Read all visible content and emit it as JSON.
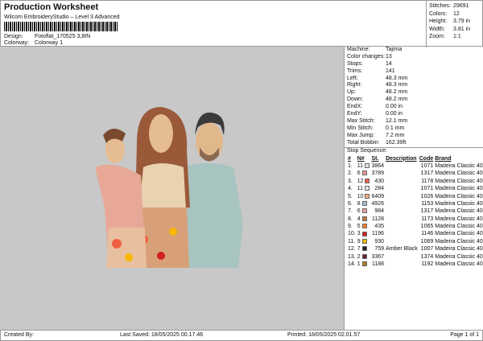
{
  "header": {
    "title": "Production Worksheet",
    "subtitle": "Wilcom EmbroideryStudio – Level 3 Advanced",
    "design_label": "Design:",
    "design_value": "Fotoflat_170525 3,8IN",
    "colorway_label": "Colorway:",
    "colorway_value": "Colorway 1"
  },
  "stats": [
    {
      "k": "Stitches:",
      "v": "29691"
    },
    {
      "k": "Colors:",
      "v": "12"
    },
    {
      "k": "Height:",
      "v": "3.79 in"
    },
    {
      "k": "Width:",
      "v": "3.81 in"
    },
    {
      "k": "Zoom:",
      "v": "1:1"
    }
  ],
  "info": [
    {
      "k": "Machine:",
      "v": "Tajima"
    },
    {
      "k": "Color changes:",
      "v": "13"
    },
    {
      "k": "Stops:",
      "v": "14"
    },
    {
      "k": "Trims:",
      "v": "141"
    },
    {
      "k": "Left:",
      "v": "48.3 mm"
    },
    {
      "k": "Right:",
      "v": "48.3 mm"
    },
    {
      "k": "Up:",
      "v": "48.2 mm"
    },
    {
      "k": "Down:",
      "v": "48.2 mm"
    },
    {
      "k": "EndX:",
      "v": "0.00 in"
    },
    {
      "k": "EndY:",
      "v": "0.00 in"
    },
    {
      "k": "Max Stitch:",
      "v": "12.1 mm"
    },
    {
      "k": "Min Stitch:",
      "v": "0.1 mm"
    },
    {
      "k": "Max Jump:",
      "v": "7.2 mm"
    },
    {
      "k": "Total Bobbin:",
      "v": "162.39ft"
    }
  ],
  "stop_sequence": {
    "title": "Stop Sequence:",
    "headers": [
      "#",
      "N#",
      "St.",
      "Description",
      "Code",
      "Brand"
    ],
    "rows": [
      [
        "1.",
        "11",
        "#e8e2dc",
        "3864",
        "",
        "1071",
        "Madeira Classic 40"
      ],
      [
        "2.",
        "6",
        "#e89a94",
        "3789",
        "",
        "1317",
        "Madeira Classic 40"
      ],
      [
        "3.",
        "12",
        "#f06040",
        "430",
        "",
        "1178",
        "Madeira Classic 40"
      ],
      [
        "4.",
        "11",
        "#ece2d8",
        "284",
        "",
        "1071",
        "Madeira Classic 40"
      ],
      [
        "5.",
        "10",
        "#f0b080",
        "6409",
        "",
        "1026",
        "Madeira Classic 40"
      ],
      [
        "6.",
        "8",
        "#a8bcd4",
        "4926",
        "",
        "1153",
        "Madeira Classic 40"
      ],
      [
        "7.",
        "6",
        "#e8a0a0",
        "984",
        "",
        "1317",
        "Madeira Classic 40"
      ],
      [
        "8.",
        "4",
        "#c07840",
        "1128",
        "",
        "1173",
        "Madeira Classic 40"
      ],
      [
        "9.",
        "5",
        "#f08030",
        "435",
        "",
        "1065",
        "Madeira Classic 40"
      ],
      [
        "10.",
        "3",
        "#d02020",
        "1196",
        "",
        "1146",
        "Madeira Classic 40"
      ],
      [
        "11.",
        "9",
        "#f8b800",
        "930",
        "",
        "1069",
        "Madeira Classic 40"
      ],
      [
        "12.",
        "7",
        "#202020",
        "759",
        "Amber Black",
        "1007",
        "Madeira Classic 40"
      ],
      [
        "13.",
        "2",
        "#602030",
        "3367",
        "",
        "1374",
        "Madeira Classic 40"
      ],
      [
        "14.",
        "1",
        "#b07820",
        "1188",
        "",
        "1192",
        "Madeira Classic 40"
      ]
    ]
  },
  "footer": {
    "created": "Created By:",
    "saved": "Last Saved: 18/05/2025 00.17.46",
    "printed": "Printed: 18/05/2025 02.01.57",
    "page": "Page 1 of 1"
  }
}
